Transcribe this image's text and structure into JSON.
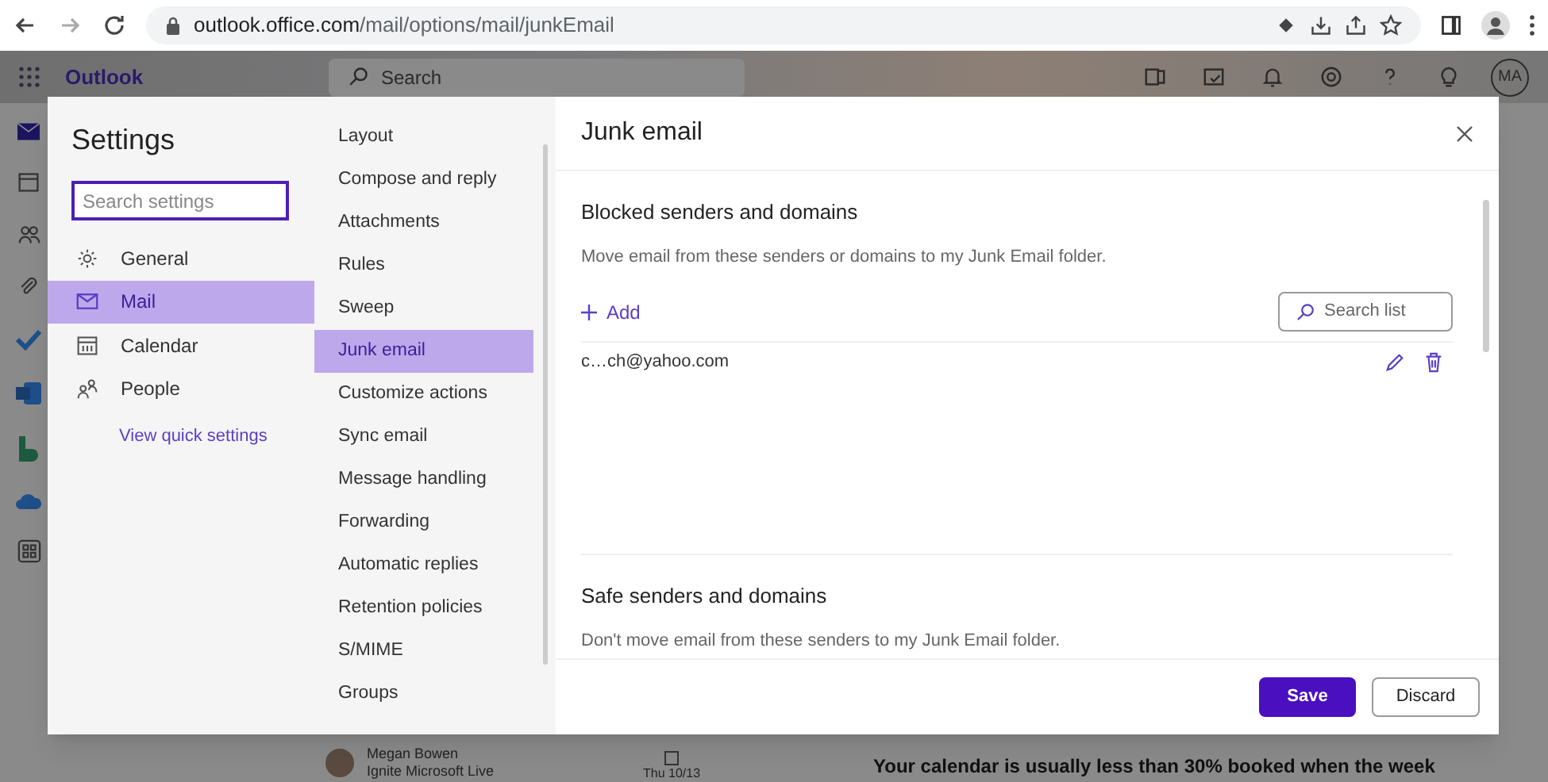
{
  "browser": {
    "url_host": "outlook.office.com",
    "url_path": "/mail/options/mail/junkEmail"
  },
  "app": {
    "name": "Outlook",
    "search_placeholder": "Search",
    "avatar": "MA"
  },
  "background": {
    "sender": "Megan Bowen",
    "subject": "Ignite Microsoft Live",
    "date": "Thu 10/13",
    "insight": "Your calendar is usually less than 30% booked when the week"
  },
  "settings": {
    "title": "Settings",
    "search_placeholder": "Search settings",
    "categories": [
      {
        "label": "General",
        "selected": false
      },
      {
        "label": "Mail",
        "selected": true
      },
      {
        "label": "Calendar",
        "selected": false
      },
      {
        "label": "People",
        "selected": false
      }
    ],
    "quick_link": "View quick settings",
    "mail_pages": [
      {
        "label": "Layout",
        "selected": false
      },
      {
        "label": "Compose and reply",
        "selected": false
      },
      {
        "label": "Attachments",
        "selected": false
      },
      {
        "label": "Rules",
        "selected": false
      },
      {
        "label": "Sweep",
        "selected": false
      },
      {
        "label": "Junk email",
        "selected": true
      },
      {
        "label": "Customize actions",
        "selected": false
      },
      {
        "label": "Sync email",
        "selected": false
      },
      {
        "label": "Message handling",
        "selected": false
      },
      {
        "label": "Forwarding",
        "selected": false
      },
      {
        "label": "Automatic replies",
        "selected": false
      },
      {
        "label": "Retention policies",
        "selected": false
      },
      {
        "label": "S/MIME",
        "selected": false
      },
      {
        "label": "Groups",
        "selected": false
      }
    ]
  },
  "panel": {
    "title": "Junk email",
    "blocked": {
      "heading": "Blocked senders and domains",
      "description": "Move email from these senders or domains to my Junk Email folder.",
      "add": "Add",
      "search_placeholder": "Search list",
      "entries": [
        "c…ch@yahoo.com"
      ]
    },
    "safe": {
      "heading": "Safe senders and domains",
      "description": "Don't move email from these senders to my Junk Email folder."
    },
    "buttons": [
      "Save",
      "Discard"
    ]
  }
}
